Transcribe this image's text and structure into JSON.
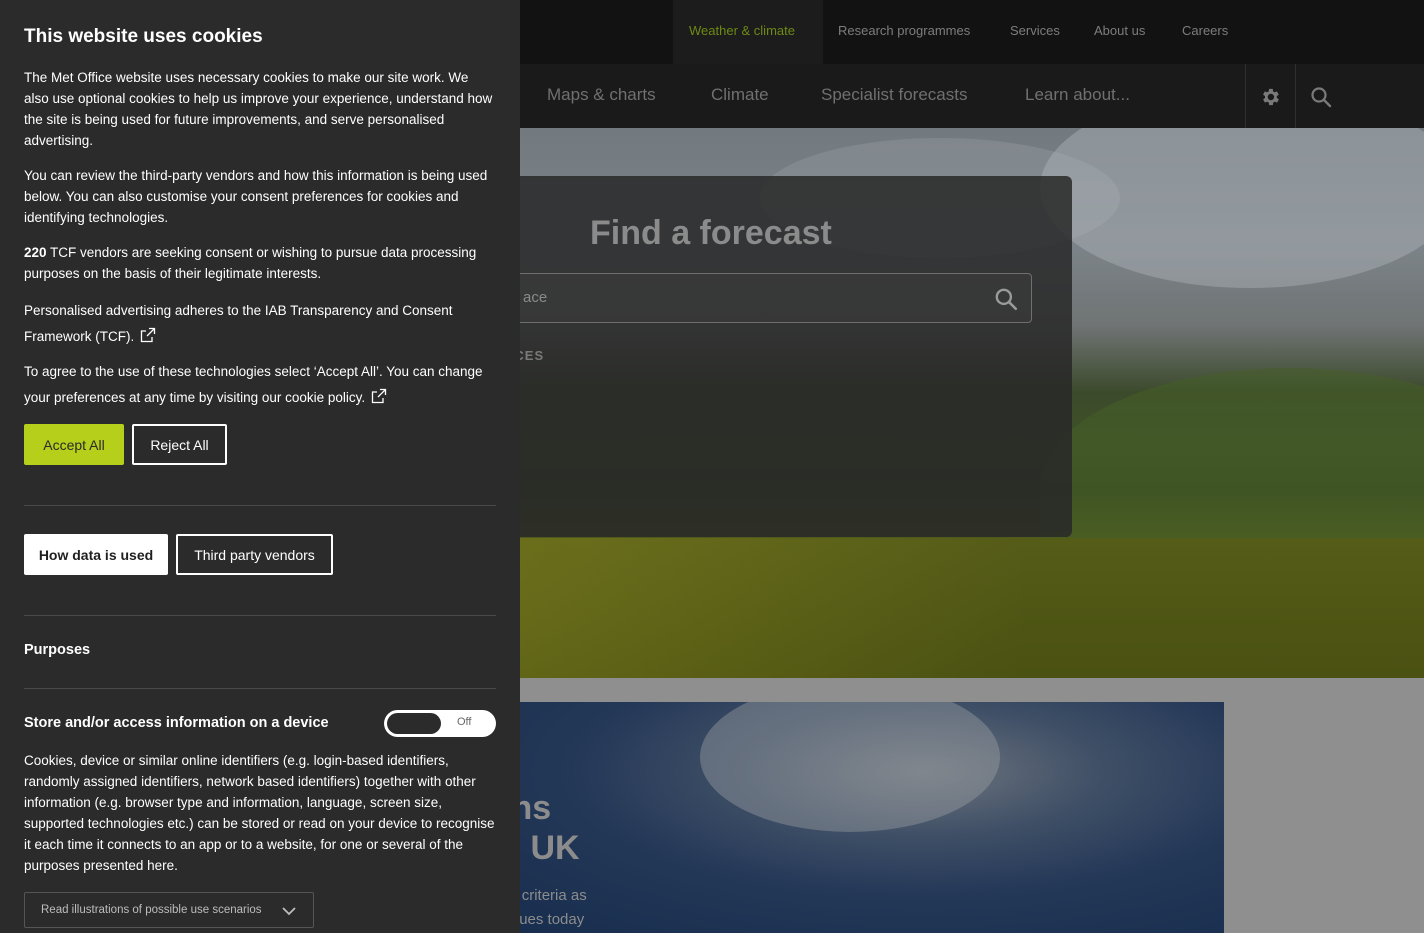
{
  "topnav": {
    "items": [
      "Weather & climate",
      "Research programmes",
      "Services",
      "About us",
      "Careers"
    ]
  },
  "mainnav": {
    "items": [
      "Maps & charts",
      "Climate",
      "Specialist forecasts",
      "Learn about..."
    ],
    "icons": [
      "gear-icon",
      "search-icon"
    ]
  },
  "forecast": {
    "title": "Find a forecast",
    "search_partial": "ace",
    "places_partial": "ACES"
  },
  "promo": {
    "title_line1": "tions",
    "title_line2": "the UK",
    "text_line1": "atwave criteria as",
    "text_line2": "r continues today"
  },
  "cookie": {
    "title": "This website uses cookies",
    "p1": "The Met Office website uses necessary cookies to make our site work. We also use optional cookies to help us improve your experience, understand how the site is being used for future improvements, and serve personalised advertising.",
    "p2": "You can review the third-party vendors and how this information is being used below. You can also customise your consent preferences for cookies and identifying technologies.",
    "p3_count": "220",
    "p3_rest": " TCF vendors are seeking consent or wishing to pursue data processing purposes on the basis of their legitimate interests.",
    "p4": "Personalised advertising adheres to the IAB Transparency and Consent Framework (TCF).",
    "p5": "To agree to the use of these technologies select ‘Accept All’. You can change your preferences at any time by visiting our cookie policy.",
    "accept_label": "Accept All",
    "reject_label": "Reject All",
    "tab_data_label": "How data is used",
    "tab_vendors_label": "Third party vendors",
    "purposes_heading": "Purposes",
    "store_heading": "Store and/or access information on a device",
    "toggle_state": "Off",
    "store_desc": "Cookies, device or similar online identifiers (e.g. login-based identifiers, randomly assigned identifiers, network based identifiers) together with other information (e.g. browser type and information, language, screen size, supported technologies etc.) can be stored or read on your device to recognise it each time it connects to an app or to a website, for one or several of the purposes presented here.",
    "scenario_label": "Read illustrations of possible use scenarios"
  },
  "colors": {
    "accent": "#b5cf1a",
    "panel_bg": "#2b2b2b",
    "active_nav": "#6d8a14"
  }
}
